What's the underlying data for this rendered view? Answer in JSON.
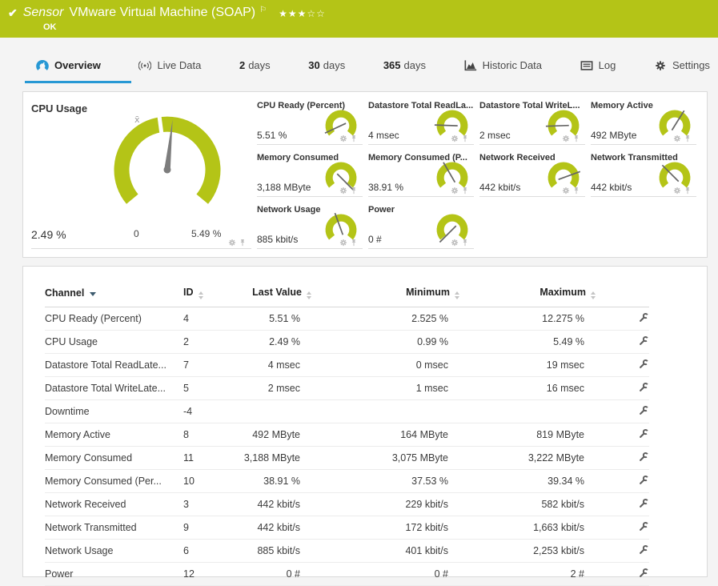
{
  "colors": {
    "brand_green": "#b4c417",
    "accent_blue": "#2798d4"
  },
  "header": {
    "kind": "Sensor",
    "title": "VMware Virtual Machine (SOAP)",
    "status": "OK",
    "stars": "★★★☆☆"
  },
  "tabs": [
    {
      "label": "Overview",
      "active": true
    },
    {
      "label": "Live Data"
    },
    {
      "num": "2",
      "label": "days"
    },
    {
      "num": "30",
      "label": "days"
    },
    {
      "num": "365",
      "label": "days"
    },
    {
      "label": "Historic Data"
    },
    {
      "label": "Log"
    },
    {
      "label": "Settings"
    }
  ],
  "main_gauge": {
    "title": "CPU Usage",
    "value": "2.49 %",
    "min": "0",
    "max": "5.49 %",
    "avg_label": "x̄",
    "needle_deg": 6
  },
  "mini_gauges": [
    {
      "label": "CPU Ready (Percent)",
      "value": "5.51 %",
      "needle_deg": -115
    },
    {
      "label": "Datastore Total ReadLa...",
      "value": "4 msec",
      "needle_deg": -88
    },
    {
      "label": "Datastore Total WriteL...",
      "value": "2 msec",
      "needle_deg": -92
    },
    {
      "label": "Memory Active",
      "value": "492 MByte",
      "needle_deg": 32
    },
    {
      "label": "Memory Consumed",
      "value": "3,188 MByte",
      "needle_deg": 135
    },
    {
      "label": "Memory Consumed (P...",
      "value": "38.91 %",
      "needle_deg": -30
    },
    {
      "label": "Network Received",
      "value": "442 kbit/s",
      "needle_deg": 70
    },
    {
      "label": "Network Transmitted",
      "value": "442 kbit/s",
      "needle_deg": -45
    },
    {
      "label": "Network Usage",
      "value": "885 kbit/s",
      "needle_deg": -20
    },
    {
      "label": "Power",
      "value": "0 #",
      "needle_deg": -135
    }
  ],
  "channel_table": {
    "columns": [
      {
        "label": "Channel",
        "sort": "desc"
      },
      {
        "label": "ID"
      },
      {
        "label": "Last Value"
      },
      {
        "label": "Minimum"
      },
      {
        "label": "Maximum"
      }
    ],
    "rows": [
      [
        "CPU Ready (Percent)",
        "4",
        "5.51 %",
        "2.525 %",
        "12.275 %"
      ],
      [
        "CPU Usage",
        "2",
        "2.49 %",
        "0.99 %",
        "5.49 %"
      ],
      [
        "Datastore Total ReadLate...",
        "7",
        "4 msec",
        "0 msec",
        "19 msec"
      ],
      [
        "Datastore Total WriteLate...",
        "5",
        "2 msec",
        "1 msec",
        "16 msec"
      ],
      [
        "Downtime",
        "-4",
        "",
        "",
        ""
      ],
      [
        "Memory Active",
        "8",
        "492 MByte",
        "164 MByte",
        "819 MByte"
      ],
      [
        "Memory Consumed",
        "11",
        "3,188 MByte",
        "3,075 MByte",
        "3,222 MByte"
      ],
      [
        "Memory Consumed (Per...",
        "10",
        "38.91 %",
        "37.53 %",
        "39.34 %"
      ],
      [
        "Network Received",
        "3",
        "442 kbit/s",
        "229 kbit/s",
        "582 kbit/s"
      ],
      [
        "Network Transmitted",
        "9",
        "442 kbit/s",
        "172 kbit/s",
        "1,663 kbit/s"
      ],
      [
        "Network Usage",
        "6",
        "885 kbit/s",
        "401 kbit/s",
        "2,253 kbit/s"
      ],
      [
        "Power",
        "12",
        "0 #",
        "0 #",
        "2 #"
      ]
    ]
  }
}
